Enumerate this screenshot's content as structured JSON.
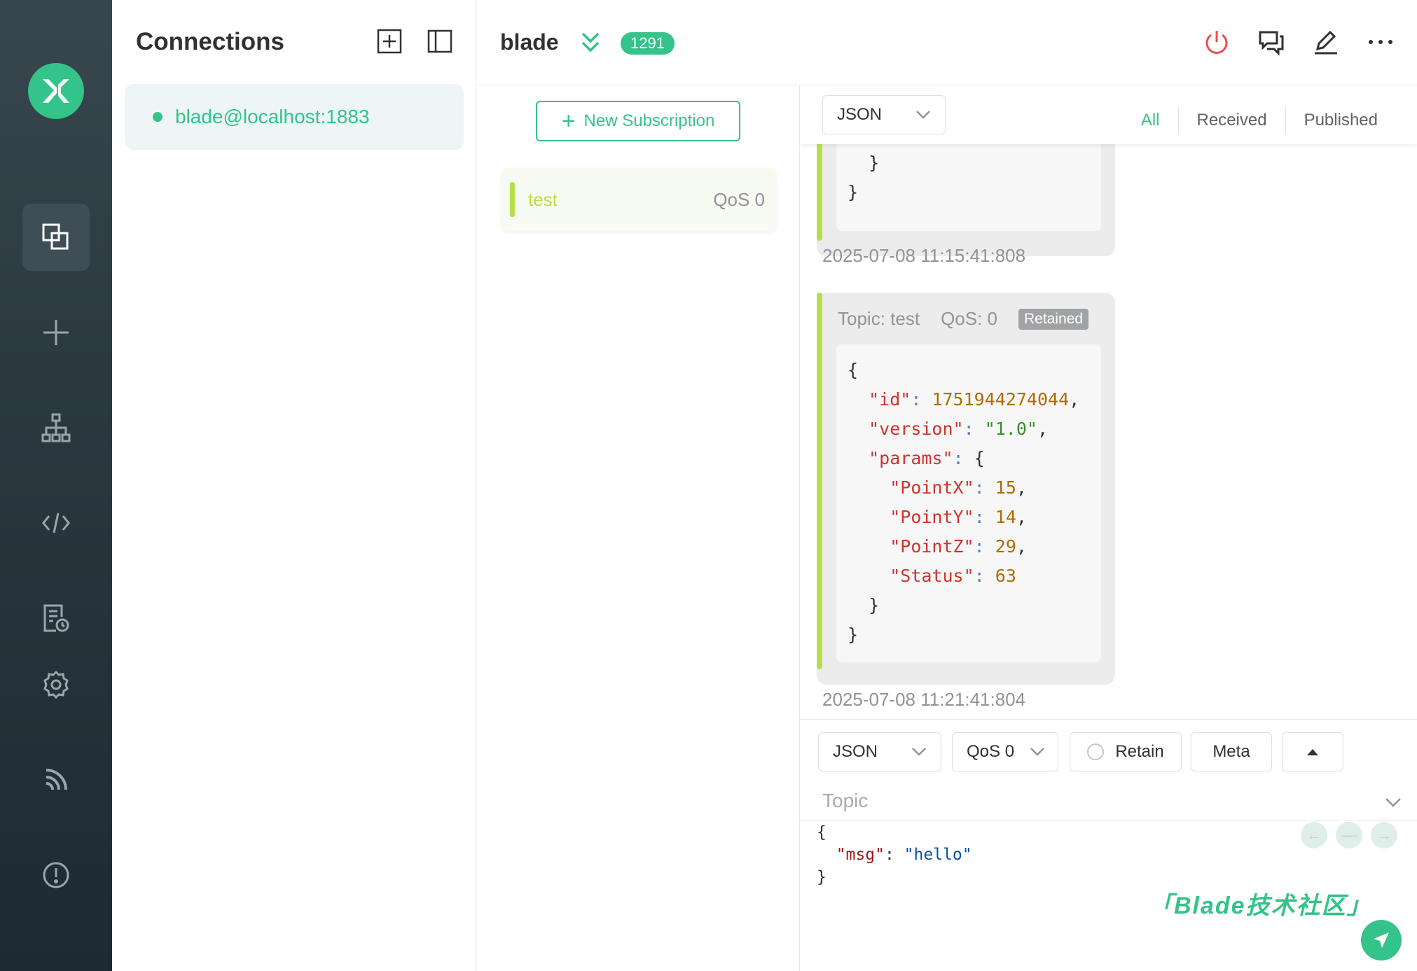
{
  "sidebar": {
    "title": "Connections",
    "connections": [
      {
        "name": "blade@localhost:1883",
        "status_color": "#34c388"
      }
    ],
    "nav_icons": [
      "connections-icon",
      "plus-icon",
      "topology-icon",
      "code-icon",
      "log-icon",
      "gear-icon",
      "feed-icon",
      "info-icon"
    ]
  },
  "header": {
    "connection_name": "blade",
    "message_count": "1291"
  },
  "subscriptions": {
    "new_button_label": "New Subscription",
    "items": [
      {
        "topic": "test",
        "qos": "QoS 0",
        "color": "#b6e04b"
      }
    ]
  },
  "messages": {
    "format": "JSON",
    "filters": [
      "All",
      "Received",
      "Published"
    ],
    "active_filter": "All",
    "partial_tail": [
      "  }",
      "}"
    ],
    "partial_timestamp": "2025-07-08 11:15:41:808",
    "items": [
      {
        "topic_label": "Topic: test",
        "qos_label": "QoS: 0",
        "retained_label": "Retained",
        "timestamp": "2025-07-08 11:21:41:804",
        "payload": {
          "id": "1751944274044",
          "version": "\"1.0\"",
          "params": {
            "PointX": "15",
            "PointY": "14",
            "PointZ": "29",
            "Status": "63"
          }
        }
      }
    ]
  },
  "publish": {
    "format": "JSON",
    "qos": "QoS 0",
    "retain_label": "Retain",
    "meta_label": "Meta",
    "topic_placeholder": "Topic",
    "payload_key": "\"msg\"",
    "payload_value": "\"hello\"",
    "watermark": "「Blade技术社区」"
  },
  "colors": {
    "accent": "#34c388",
    "topic": "#b6e04b",
    "disconnect": "#e84e4e"
  }
}
